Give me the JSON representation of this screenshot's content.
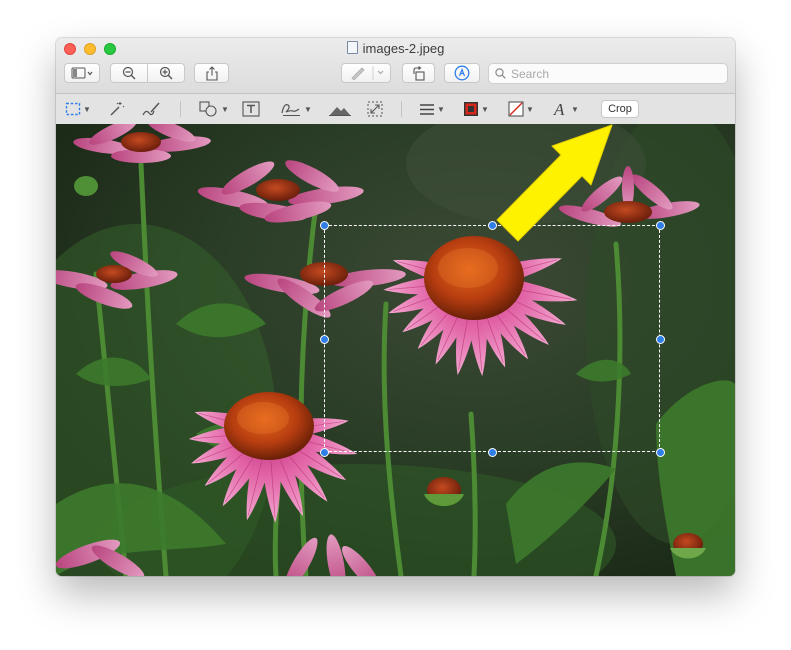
{
  "window": {
    "title": "images-2.jpeg"
  },
  "toolbar": {
    "sidebar_button": "sidebar-icon",
    "zoom_out": "zoom-out-icon",
    "zoom_in": "zoom-in-icon",
    "share": "share-icon",
    "highlight": "highlight-pen-icon",
    "rotate": "rotate-icon",
    "markup": "markup-icon",
    "search_placeholder": "Search"
  },
  "markup_toolbar": {
    "tools": [
      "rectangular-selection-icon",
      "instant-alpha-icon",
      "sketch-icon",
      "shapes-icon",
      "text-icon",
      "sign-icon",
      "adjust-color-icon",
      "adjust-size-icon",
      "shape-style-icon",
      "border-color-icon",
      "fill-color-icon",
      "text-style-icon"
    ],
    "crop_label": "Crop"
  },
  "colors": {
    "border_color": "#d8271b",
    "arrow_color": "#fff200",
    "handle_color": "#2f7fe6"
  },
  "canvas": {
    "content": "photo of pink coneflowers (echinacea) with a rectangular selection marquee and a yellow arrow pointing to the Crop button"
  }
}
